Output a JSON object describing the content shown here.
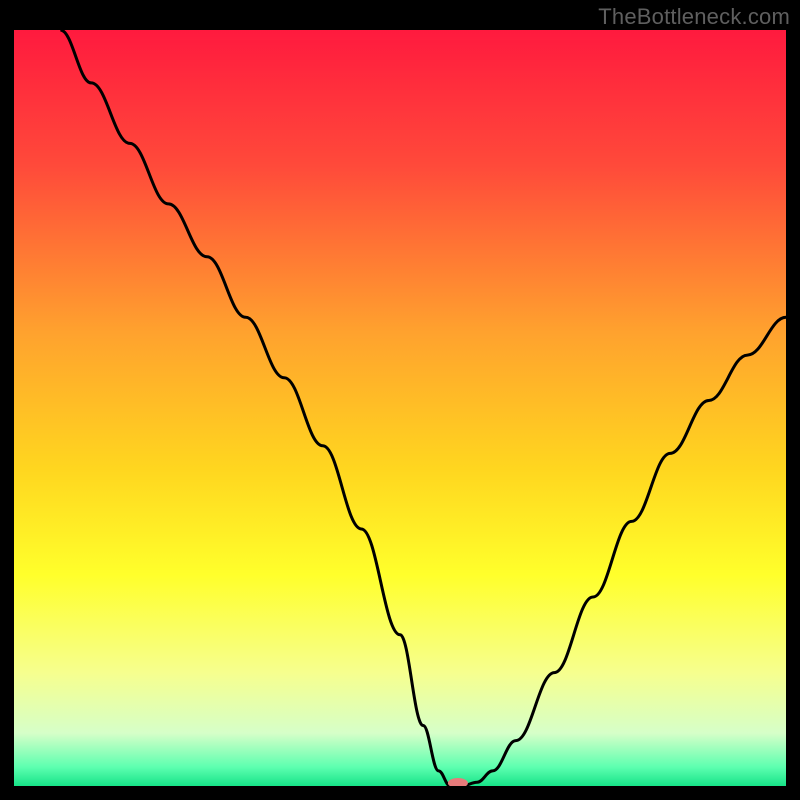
{
  "watermark": "TheBottleneck.com",
  "chart_data": {
    "type": "line",
    "title": "",
    "xlabel": "",
    "ylabel": "",
    "xlim": [
      0,
      100
    ],
    "ylim": [
      0,
      100
    ],
    "grid": false,
    "legend": false,
    "background_gradient": {
      "stops": [
        {
          "offset": 0.0,
          "color": "#ff1a3e"
        },
        {
          "offset": 0.18,
          "color": "#ff4a3a"
        },
        {
          "offset": 0.4,
          "color": "#ffa22e"
        },
        {
          "offset": 0.58,
          "color": "#ffd61f"
        },
        {
          "offset": 0.72,
          "color": "#ffff2b"
        },
        {
          "offset": 0.85,
          "color": "#f6ff8e"
        },
        {
          "offset": 0.93,
          "color": "#d6ffc8"
        },
        {
          "offset": 0.975,
          "color": "#5dffb0"
        },
        {
          "offset": 1.0,
          "color": "#17e388"
        }
      ]
    },
    "series": [
      {
        "name": "bottleneck-curve",
        "color": "#000000",
        "x": [
          6,
          10,
          15,
          20,
          25,
          30,
          35,
          40,
          45,
          50,
          53,
          55,
          56.5,
          58,
          60,
          62,
          65,
          70,
          75,
          80,
          85,
          90,
          95,
          100
        ],
        "y": [
          100,
          93,
          85,
          77,
          70,
          62,
          54,
          45,
          34,
          20,
          8,
          2,
          0,
          0,
          0.5,
          2,
          6,
          15,
          25,
          35,
          44,
          51,
          57,
          62
        ]
      }
    ],
    "marker": {
      "name": "optimal-point",
      "x": 57.5,
      "y": 0,
      "color": "#e77b7b",
      "rx": 10,
      "ry": 5
    }
  }
}
